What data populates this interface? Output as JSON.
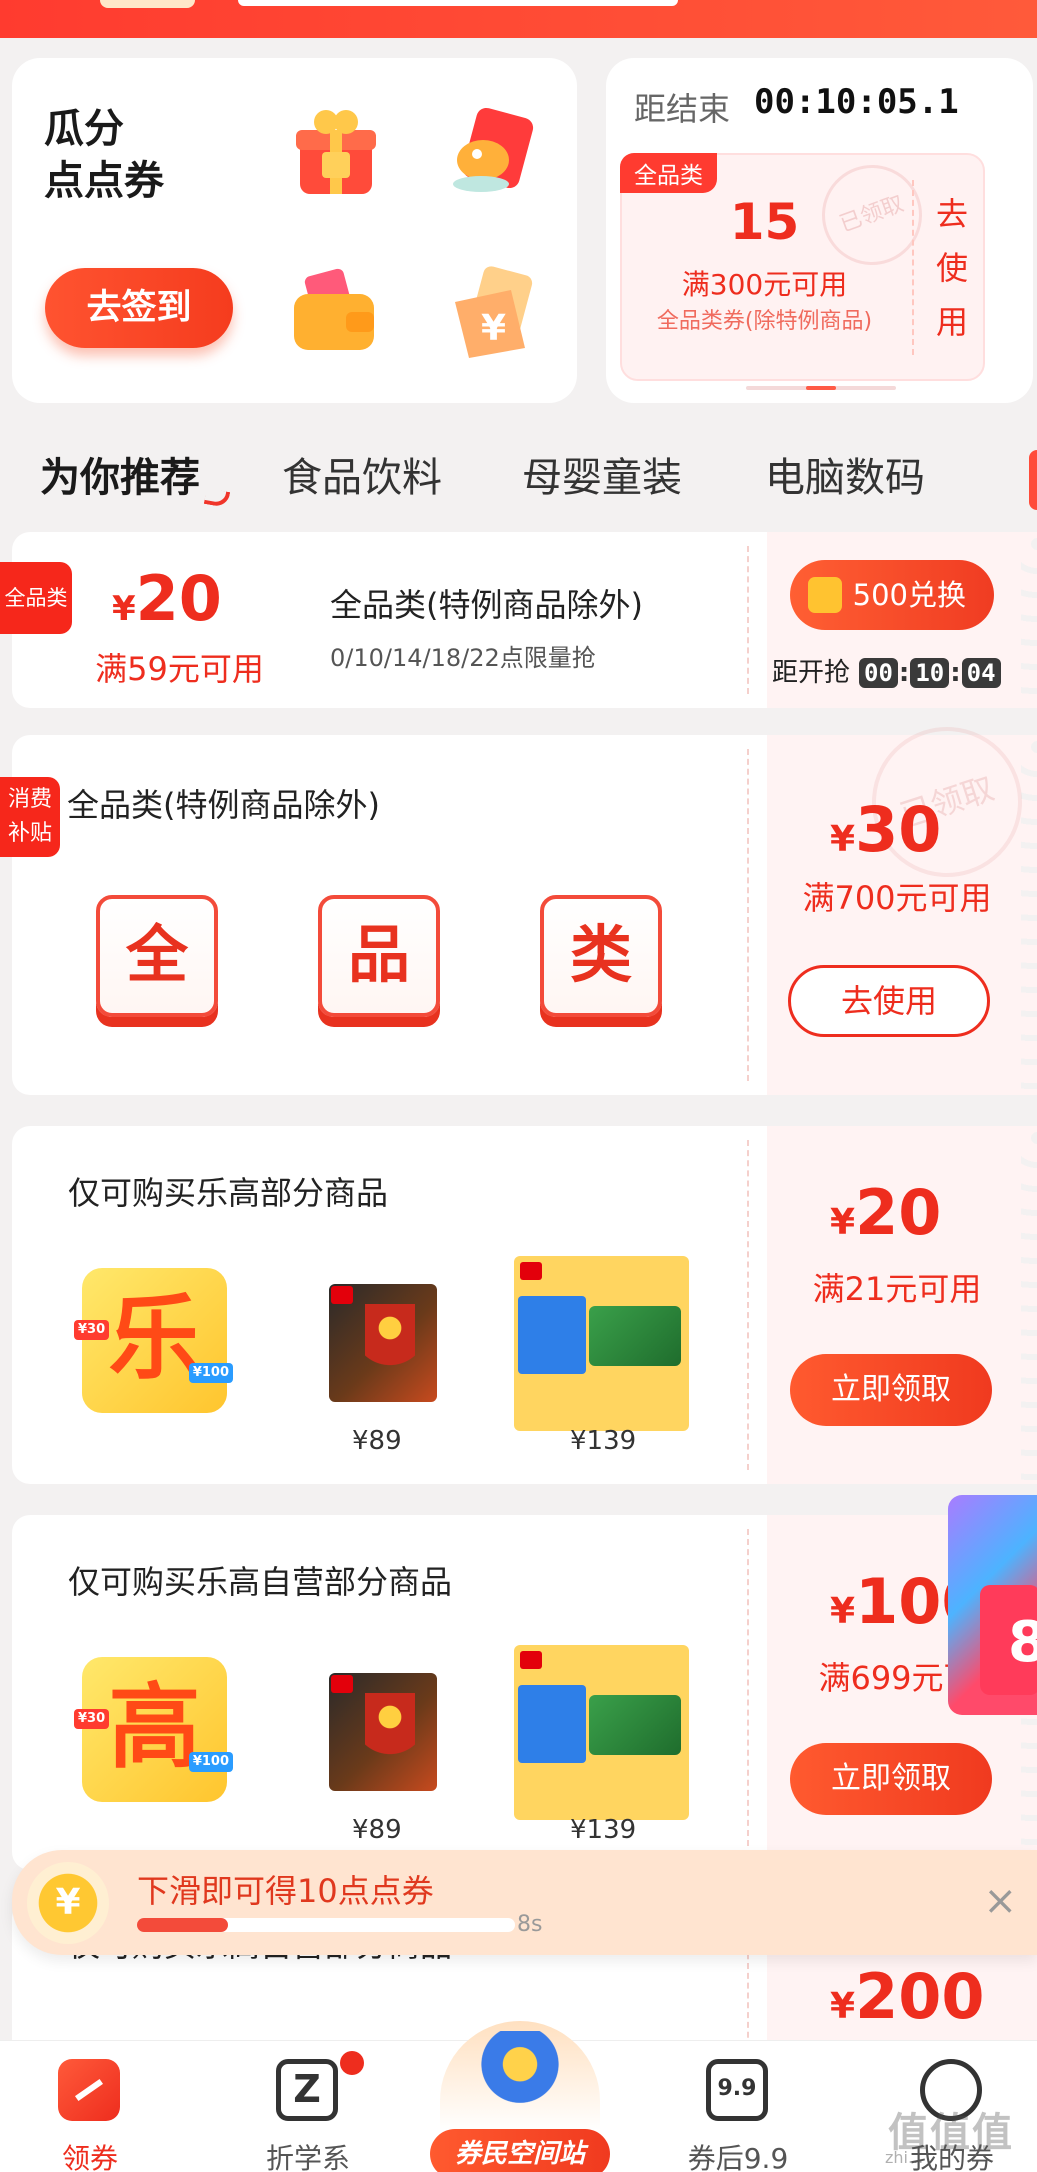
{
  "colors": {
    "accent": "#ee2d1e",
    "brand_orange": "#ff5a2f",
    "page_bg": "#f3f1f1"
  },
  "signin": {
    "title_line1": "瓜分",
    "title_line2": "点点券",
    "button": "去签到",
    "icons": [
      "gift-icon",
      "red-packet-icon",
      "wallet-icon",
      "yen-coupon-icon"
    ]
  },
  "countdown": {
    "label": "距结束",
    "time": "00:10:05.1",
    "coupon": {
      "tag": "全品类",
      "amount": "15",
      "condition": "满300元可用",
      "desc": "全品类券(除特例商品)",
      "use_line1": "去",
      "use_line2": "使",
      "use_line3": "用",
      "stamp": "已领取"
    }
  },
  "tabs": [
    {
      "label": "为你推荐",
      "active": true
    },
    {
      "label": "食品饮料"
    },
    {
      "label": "母婴童装"
    },
    {
      "label": "电脑数码"
    }
  ],
  "coupon1": {
    "tag": "全品类",
    "yen": "¥",
    "amount": "20",
    "condition": "满59元可用",
    "title": "全品类(特例商品除外)",
    "subtitle": "0/10/14/18/22点限量抢",
    "exchange_button": "500兑换",
    "starts_label": "距开抢",
    "hh": "00",
    "mm": "10",
    "ss": "04"
  },
  "coupon2": {
    "tag_line1": "消费",
    "tag_line2": "补贴",
    "title": "全品类(特例商品除外)",
    "chars": [
      "全",
      "品",
      "类"
    ],
    "yen": "¥",
    "amount": "30",
    "condition": "满700元可用",
    "button": "去使用",
    "stamp": "已领取"
  },
  "coupon3": {
    "title": "仅可购买乐高部分商品",
    "brand_char": "乐",
    "badge_30": "¥30",
    "badge_100": "¥100",
    "price1": "¥89",
    "price2": "¥139",
    "yen": "¥",
    "amount": "20",
    "condition": "满21元可用",
    "button": "立即领取"
  },
  "coupon4": {
    "title": "仅可购买乐高自营部分商品",
    "brand_char": "高",
    "badge_30": "¥30",
    "badge_100": "¥100",
    "price1": "¥89",
    "price2": "¥139",
    "yen": "¥",
    "amount": "100",
    "condition": "满699元可",
    "button": "立即领取",
    "float_number": "8"
  },
  "swipe_banner": {
    "coin_symbol": "¥",
    "text": "下滑即可得10点点券",
    "timer": "8s",
    "progress_percent": 24,
    "close": "×"
  },
  "coupon5": {
    "title": "仅可购买乐高自营部分商品",
    "yen": "¥",
    "amount": "200"
  },
  "bottom_nav": {
    "items": [
      {
        "label": "领券",
        "icon": "coupon-icon",
        "active": true
      },
      {
        "label": "折学系",
        "icon": "z-icon",
        "badge": true
      },
      {
        "label": "券民空间站",
        "icon": "lego-figure-icon"
      },
      {
        "label": "券后9.9",
        "icon": "nine-nine-icon",
        "icon_text": "9.9"
      },
      {
        "label": "我的券",
        "icon": "profile-icon"
      }
    ]
  },
  "watermark": {
    "text": "值值值",
    "sub": "zhi..."
  }
}
